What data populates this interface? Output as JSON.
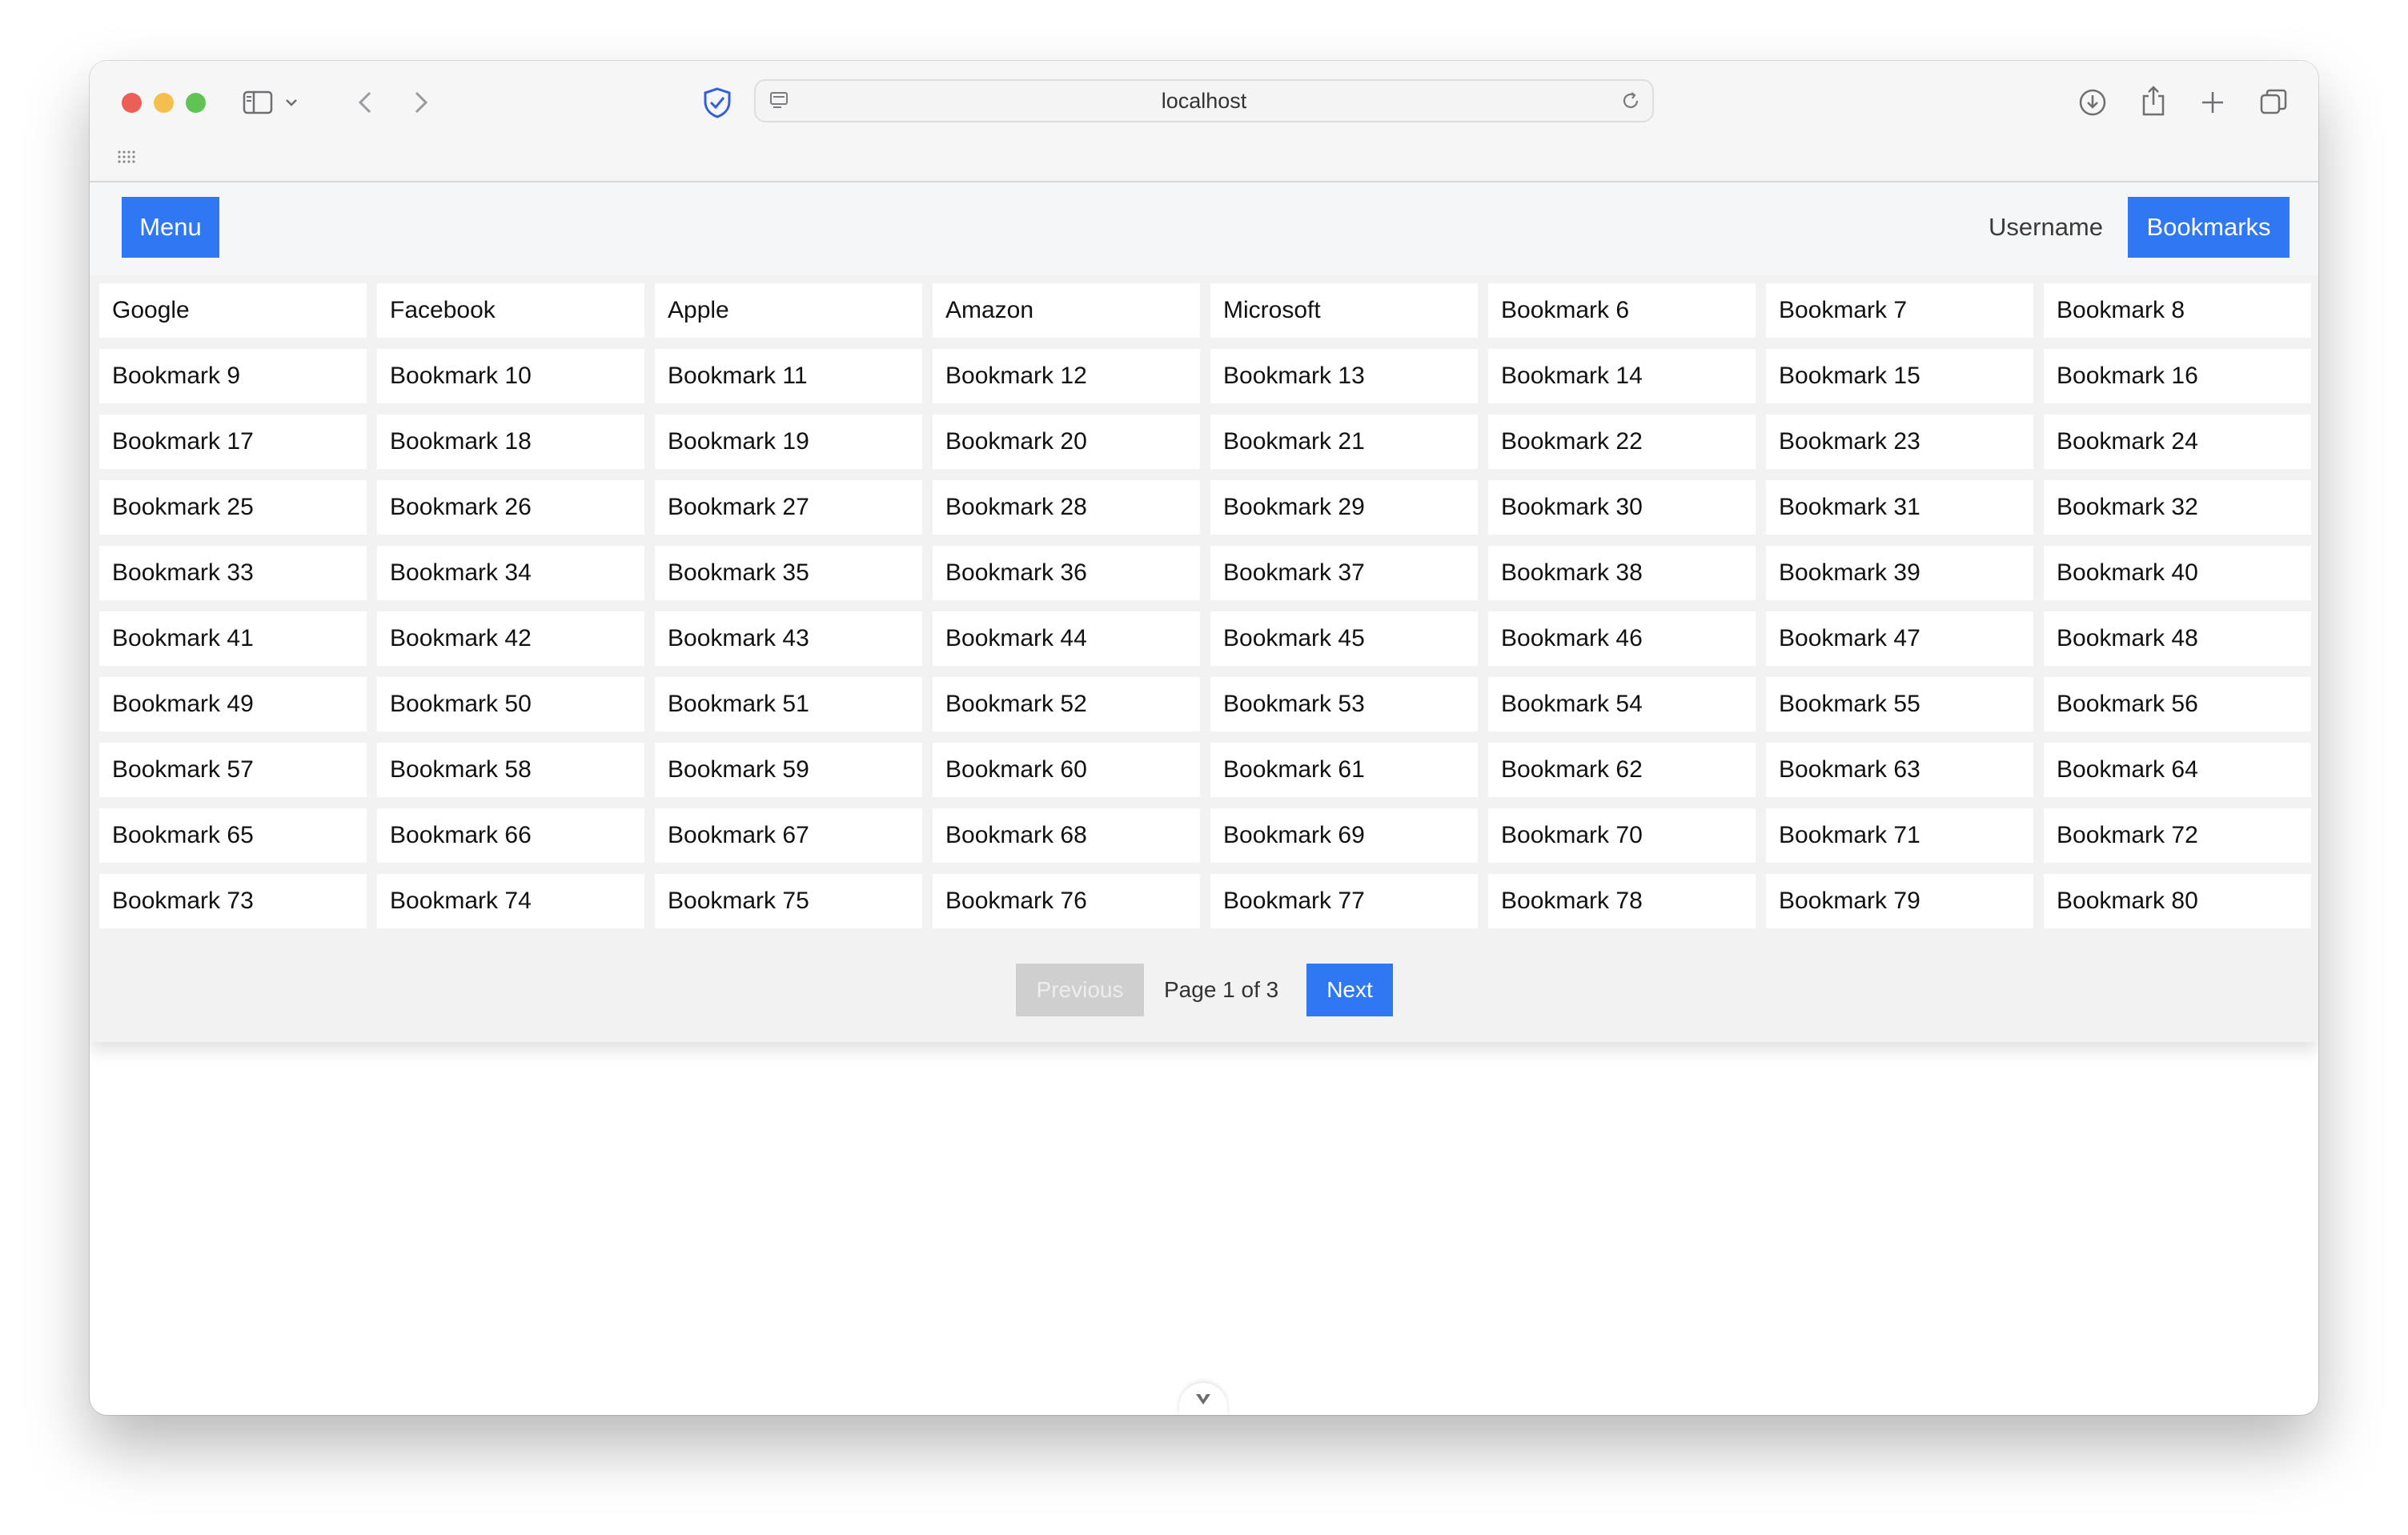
{
  "browser": {
    "url": "localhost",
    "icons": [
      "sidebar-icon",
      "chevron-down-icon",
      "back-icon",
      "forward-icon",
      "shield-icon",
      "page-icon",
      "reload-icon",
      "download-icon",
      "share-icon",
      "plus-icon",
      "tabs-icon",
      "grid-dots-icon"
    ]
  },
  "navbar": {
    "menu_label": "Menu",
    "username": "Username",
    "bookmarks_label": "Bookmarks"
  },
  "bookmarks": [
    "Google",
    "Facebook",
    "Apple",
    "Amazon",
    "Microsoft",
    "Bookmark 6",
    "Bookmark 7",
    "Bookmark 8",
    "Bookmark 9",
    "Bookmark 10",
    "Bookmark 11",
    "Bookmark 12",
    "Bookmark 13",
    "Bookmark 14",
    "Bookmark 15",
    "Bookmark 16",
    "Bookmark 17",
    "Bookmark 18",
    "Bookmark 19",
    "Bookmark 20",
    "Bookmark 21",
    "Bookmark 22",
    "Bookmark 23",
    "Bookmark 24",
    "Bookmark 25",
    "Bookmark 26",
    "Bookmark 27",
    "Bookmark 28",
    "Bookmark 29",
    "Bookmark 30",
    "Bookmark 31",
    "Bookmark 32",
    "Bookmark 33",
    "Bookmark 34",
    "Bookmark 35",
    "Bookmark 36",
    "Bookmark 37",
    "Bookmark 38",
    "Bookmark 39",
    "Bookmark 40",
    "Bookmark 41",
    "Bookmark 42",
    "Bookmark 43",
    "Bookmark 44",
    "Bookmark 45",
    "Bookmark 46",
    "Bookmark 47",
    "Bookmark 48",
    "Bookmark 49",
    "Bookmark 50",
    "Bookmark 51",
    "Bookmark 52",
    "Bookmark 53",
    "Bookmark 54",
    "Bookmark 55",
    "Bookmark 56",
    "Bookmark 57",
    "Bookmark 58",
    "Bookmark 59",
    "Bookmark 60",
    "Bookmark 61",
    "Bookmark 62",
    "Bookmark 63",
    "Bookmark 64",
    "Bookmark 65",
    "Bookmark 66",
    "Bookmark 67",
    "Bookmark 68",
    "Bookmark 69",
    "Bookmark 70",
    "Bookmark 71",
    "Bookmark 72",
    "Bookmark 73",
    "Bookmark 74",
    "Bookmark 75",
    "Bookmark 76",
    "Bookmark 77",
    "Bookmark 78",
    "Bookmark 79",
    "Bookmark 80"
  ],
  "pagination": {
    "prev_label": "Previous",
    "page_info": "Page 1 of 3",
    "next_label": "Next"
  },
  "colors": {
    "accent": "#2f77f3",
    "disabled": "#cfcfcf",
    "content_bg": "#f2f2f2"
  }
}
